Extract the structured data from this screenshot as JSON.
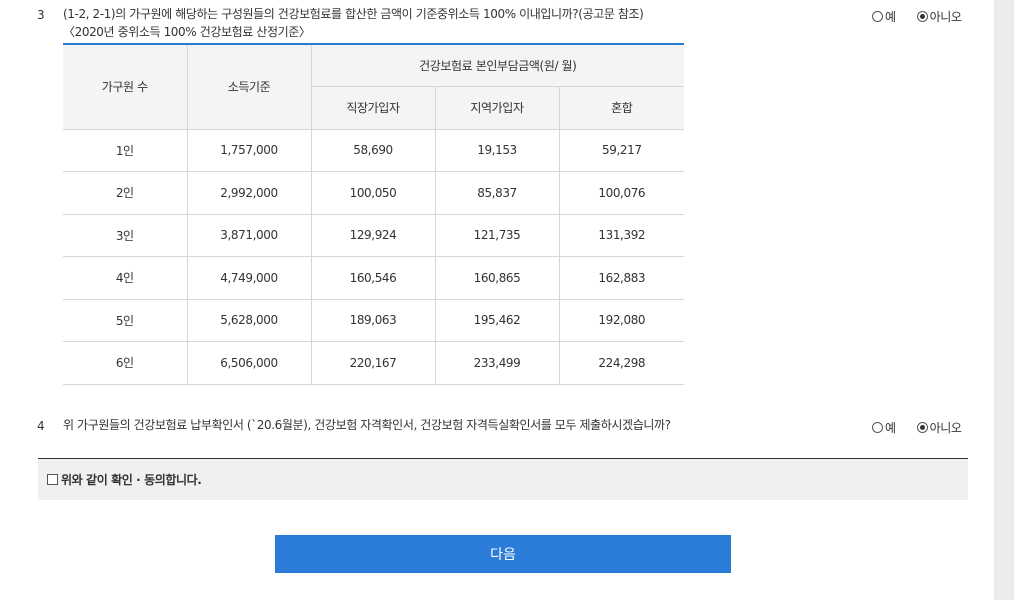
{
  "q3": {
    "number": "3",
    "text": "(1-2, 2-1)의 가구원에 해당하는 구성원들의 건강보험료를 합산한 금액이 기준중위소득 100% 이내입니까?(공고문 참조)",
    "subtext": "〈2020년 중위소득 100% 건강보험료 산정기준〉",
    "options": [
      "예",
      "아니오"
    ],
    "selected": "아니오"
  },
  "table": {
    "col_household": "가구원 수",
    "col_income": "소득기준",
    "col_group": "건강보험료 본인부담금액(원/ 월)",
    "sub_cols": [
      "직장가입자",
      "지역가입자",
      "혼합"
    ],
    "rows": [
      [
        "1인",
        "1,757,000",
        "58,690",
        "19,153",
        "59,217"
      ],
      [
        "2인",
        "2,992,000",
        "100,050",
        "85,837",
        "100,076"
      ],
      [
        "3인",
        "3,871,000",
        "129,924",
        "121,735",
        "131,392"
      ],
      [
        "4인",
        "4,749,000",
        "160,546",
        "160,865",
        "162,883"
      ],
      [
        "5인",
        "5,628,000",
        "189,063",
        "195,462",
        "192,080"
      ],
      [
        "6인",
        "6,506,000",
        "220,167",
        "233,499",
        "224,298"
      ]
    ]
  },
  "q4": {
    "number": "4",
    "text": "위 가구원들의 건강보험료 납부확인서 (`20.6월분), 건강보험 자격확인서, 건강보험 자격득실확인서를 모두 제출하시겠습니까?",
    "options": [
      "예",
      "아니오"
    ],
    "selected": "아니오"
  },
  "agree": {
    "label": "위와 같이 확인 · 동의합니다."
  },
  "next_button": {
    "label": "다음"
  }
}
